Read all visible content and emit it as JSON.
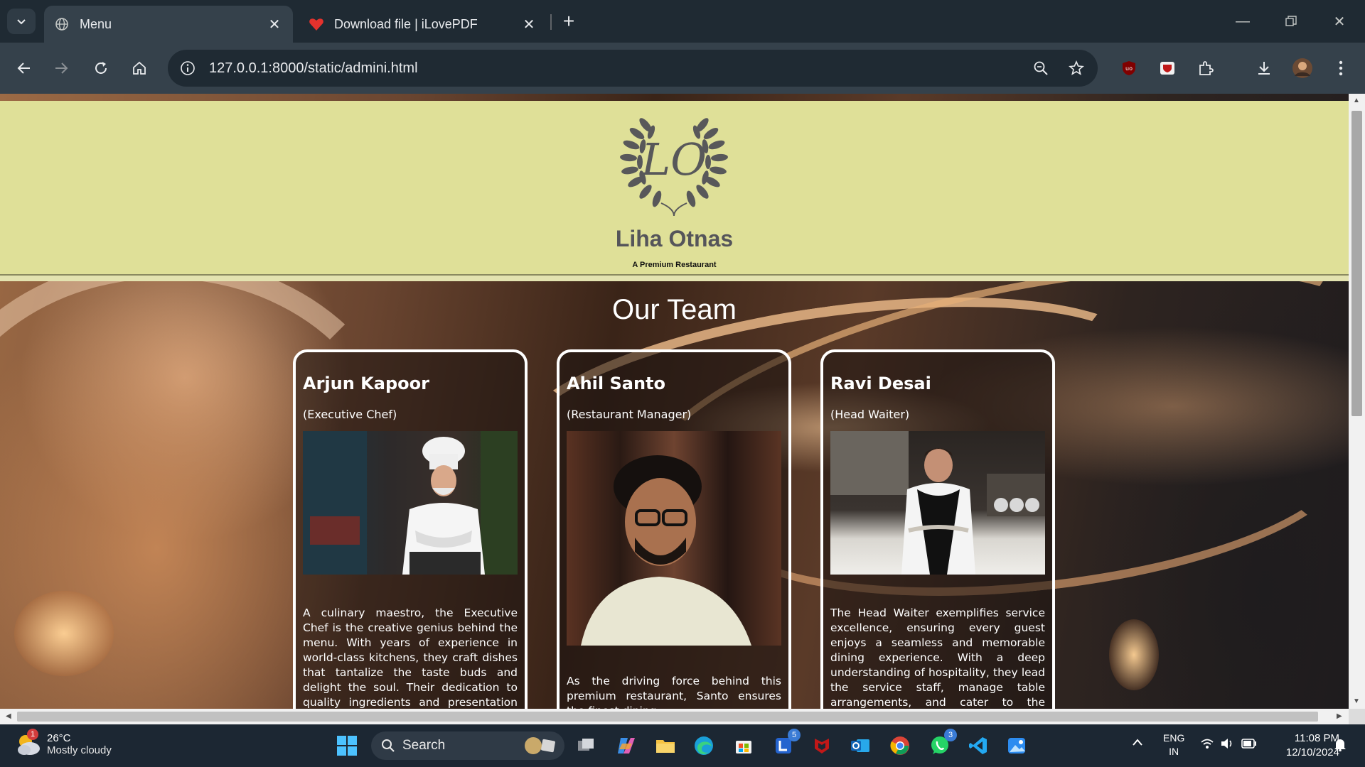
{
  "browser": {
    "tabs": [
      {
        "title": "Menu",
        "active": true,
        "icon": "globe-icon"
      },
      {
        "title": "Download file | iLovePDF",
        "active": false,
        "icon": "ilovepdf-heart-icon"
      }
    ],
    "url": "127.0.0.1:8000/static/admini.html"
  },
  "site": {
    "brand": "Liha Otnas",
    "tagline": "A Premium Restaurant",
    "logo_monogram": "LO",
    "header_color": "#dfe098"
  },
  "team": {
    "heading": "Our Team",
    "members": [
      {
        "name": "Arjun Kapoor",
        "role": "(Executive Chef)",
        "bio": "A culinary maestro, the Executive Chef is the creative genius behind the menu. With years of experience in world-class kitchens, they craft dishes that tantalize the taste buds and delight the soul. Their dedication to quality ingredients and presentation ensures every plate reflects"
      },
      {
        "name": "Ahil Santo",
        "role": "(Restaurant Manager)",
        "bio": "As the driving force behind this premium restaurant, Santo ensures the finest dining"
      },
      {
        "name": "Ravi Desai",
        "role": "(Head Waiter)",
        "bio": "The Head Waiter exemplifies service excellence, ensuring every guest enjoys a seamless and memorable dining experience. With a deep understanding of hospitality, they lead the service staff, manage table arrangements, and cater to the individual preferences of each guest."
      }
    ]
  },
  "taskbar": {
    "weather_temp": "26°C",
    "weather_condition": "Mostly cloudy",
    "weather_badge": "1",
    "search_label": "Search",
    "lang_top": "ENG",
    "lang_bottom": "IN",
    "time": "11:08 PM",
    "date": "12/10/2024",
    "badges": {
      "todo": "5",
      "whatsapp": "3"
    }
  }
}
